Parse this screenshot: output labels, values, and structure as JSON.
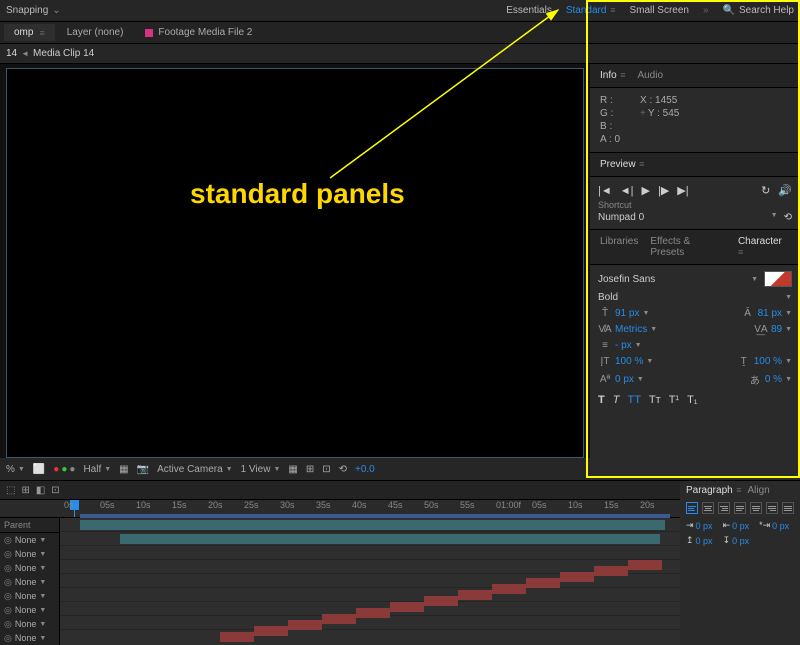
{
  "topbar": {
    "snapping": "Snapping",
    "workspaces": [
      "Essentials",
      "Standard",
      "Small Screen"
    ],
    "active_ws": "Standard",
    "search_placeholder": "Search Help"
  },
  "tabs": {
    "comp": "omp",
    "layer": "Layer (none)",
    "footage": "Footage Media File 2"
  },
  "subheader": {
    "num": "14",
    "title": "Media Clip 14"
  },
  "viewer_footer": {
    "pct": "%",
    "res": "Half",
    "cam": "Active Camera",
    "view": "1 View",
    "exposure": "+0.0"
  },
  "info": {
    "tab1": "Info",
    "tab2": "Audio",
    "r": "R :",
    "g": "G :",
    "b": "B :",
    "a": "A : 0",
    "x": "X : 1455",
    "y": "Y : 545"
  },
  "preview": {
    "title": "Preview",
    "shortcut_label": "Shortcut",
    "shortcut_val": "Numpad 0"
  },
  "char_tabs": {
    "lib": "Libraries",
    "fx": "Effects & Presets",
    "char": "Character"
  },
  "char": {
    "font": "Josefin Sans",
    "weight": "Bold",
    "size": "91 px",
    "leading": "81 px",
    "kerning": "Metrics",
    "tracking": "89",
    "px_empty": "- px",
    "scale_v": "100 %",
    "scale_h": "100 %",
    "baseline": "0 px",
    "tsume": "0 %"
  },
  "timeline": {
    "ticks": [
      "0s",
      "05s",
      "10s",
      "15s",
      "20s",
      "25s",
      "30s",
      "35s",
      "40s",
      "45s",
      "50s",
      "55s",
      "01:00f",
      "05s",
      "10s",
      "15s",
      "20s"
    ],
    "parent": "Parent",
    "none": "None"
  },
  "paragraph": {
    "tab1": "Paragraph",
    "tab2": "Align",
    "v0": "0 px"
  },
  "annotation": "standard panels"
}
